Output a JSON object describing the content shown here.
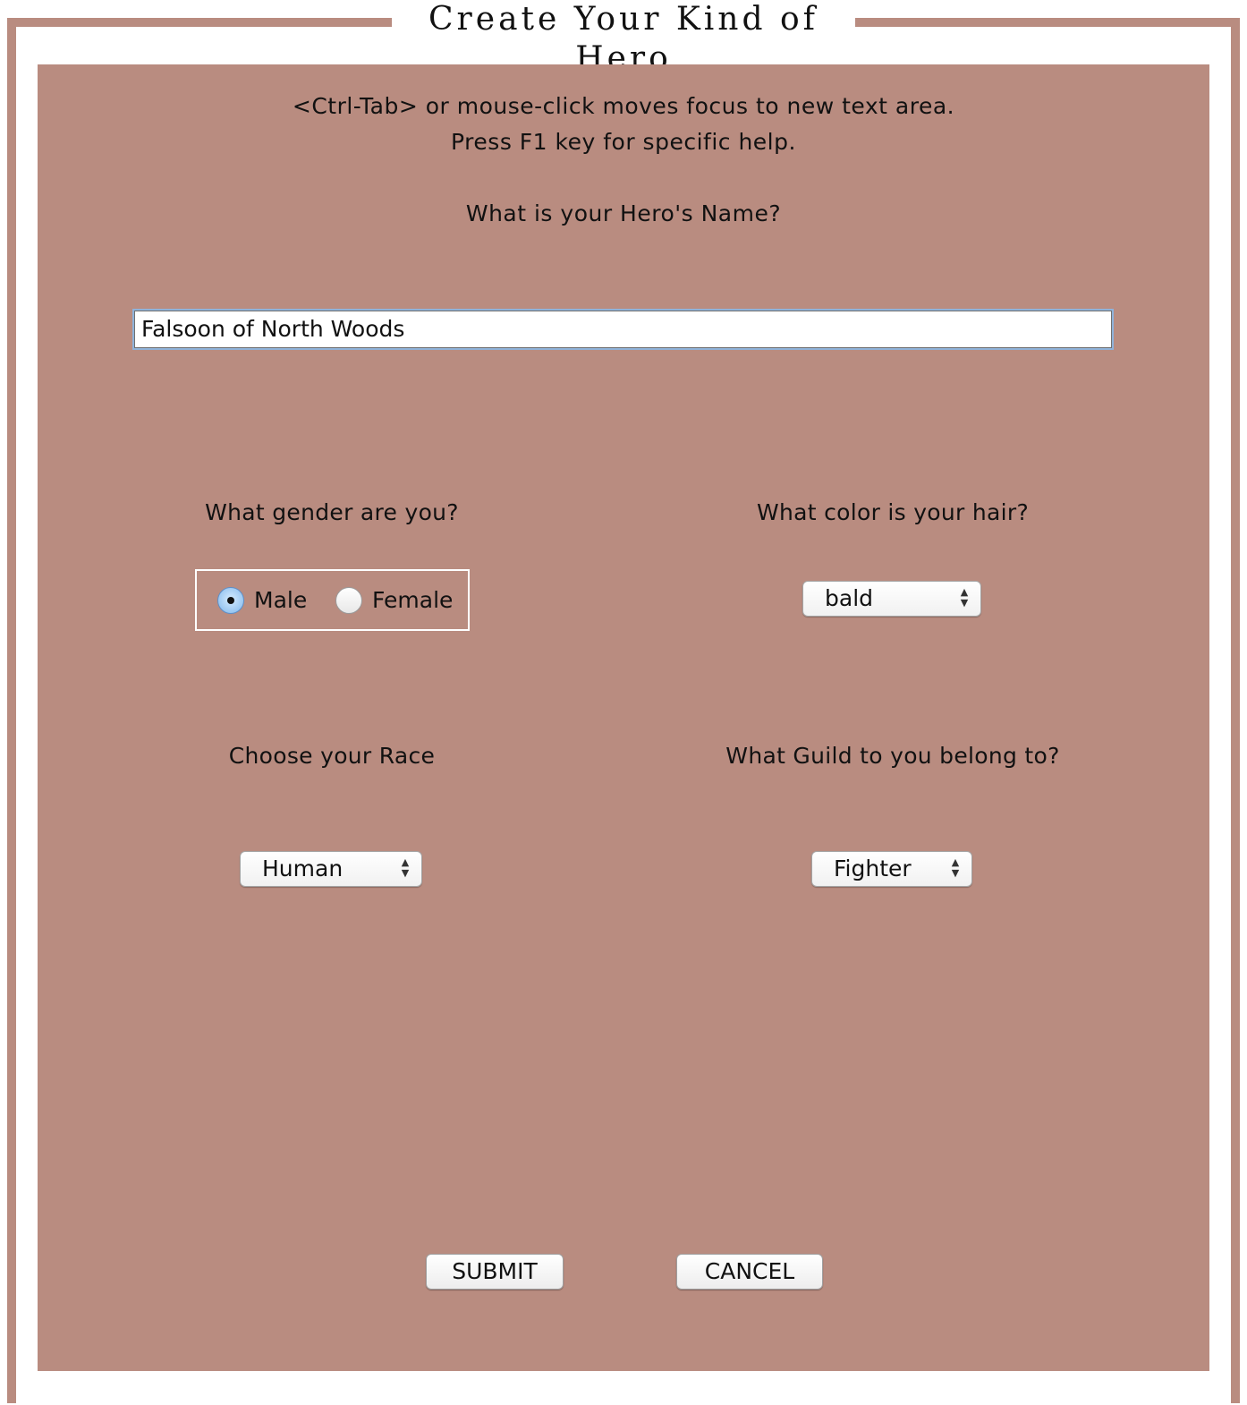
{
  "window": {
    "title": "Create Your Kind of Hero"
  },
  "instructions": {
    "line1": "<Ctrl-Tab> or mouse-click moves focus to new text area.",
    "line2": "Press F1 key for specific help."
  },
  "name": {
    "question": "What is your Hero's Name?",
    "value": "Falsoon of North Woods"
  },
  "gender": {
    "question": "What gender are you?",
    "options": [
      {
        "label": "Male",
        "checked": true
      },
      {
        "label": "Female",
        "checked": false
      }
    ]
  },
  "hair": {
    "question": "What color is your hair?",
    "selected": "bald"
  },
  "race": {
    "question": "Choose your Race",
    "selected": "Human"
  },
  "guild": {
    "question": "What Guild to you belong to?",
    "selected": "Fighter"
  },
  "buttons": {
    "submit": "SUBMIT",
    "cancel": "CANCEL"
  },
  "colors": {
    "panel": "#b98c80",
    "frame": "#b98c80",
    "focus_ring": "#8fb2d9"
  }
}
